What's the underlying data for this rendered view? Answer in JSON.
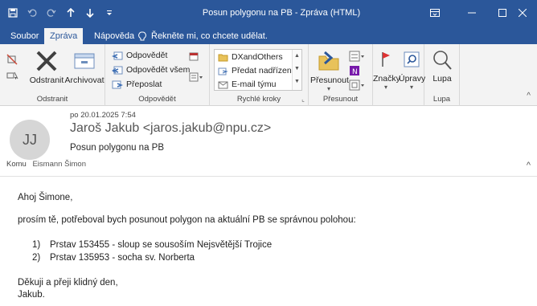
{
  "window": {
    "title": "Posun polygonu na PB  -  Zpráva (HTML)",
    "accent": "#2b579a"
  },
  "qat": {
    "icons": [
      "save-icon",
      "undo-icon",
      "redo-icon",
      "up-arrow-icon",
      "down-arrow-icon",
      "customize-icon"
    ]
  },
  "tabs": [
    {
      "label": "Soubor",
      "active": false
    },
    {
      "label": "Zpráva",
      "active": true
    },
    {
      "label": "Nápověda",
      "active": false
    }
  ],
  "tellme": {
    "label": "Řekněte mi, co chcete udělat."
  },
  "ribbon": {
    "groups": {
      "odstranit": "Odstranit",
      "odpovedet": "Odpovědět",
      "rychle_kroky": "Rychlé kroky",
      "presunout": "Přesunout",
      "lupa": "Lupa"
    },
    "delete_label": "Odstranit",
    "archive_label": "Archivovat",
    "reply_label": "Odpovědět",
    "reply_all_label": "Odpovědět všem",
    "forward_label": "Přeposlat",
    "quick_steps": [
      "DXandOthers",
      "Předat nadřízen...",
      "E-mail týmu"
    ],
    "move_label": "Přesunout",
    "tags_label": "Značky",
    "editing_label": "Úpravy",
    "zoom_label": "Lupa"
  },
  "message": {
    "date": "po 20.01.2025 7:54",
    "initials": "JJ",
    "from": "Jaroš Jakub <jaros.jakub@npu.cz>",
    "subject": "Posun polygonu na PB",
    "to_label": "Komu",
    "to": "Eismann Šimon",
    "body": {
      "greeting": "Ahoj Šimone,",
      "intro": "prosím tě, potřeboval bych posunout polygon na aktuální PB se správnou polohou:",
      "items": [
        {
          "num": "1)",
          "text": "Prstav 153455 - sloup se sousoším Nejsvětější Trojice"
        },
        {
          "num": "2)",
          "text": "Prstav  135953 - socha sv. Norberta"
        }
      ],
      "closing1": "Děkuji a přeji klidný den,",
      "closing2": "Jakub."
    }
  }
}
